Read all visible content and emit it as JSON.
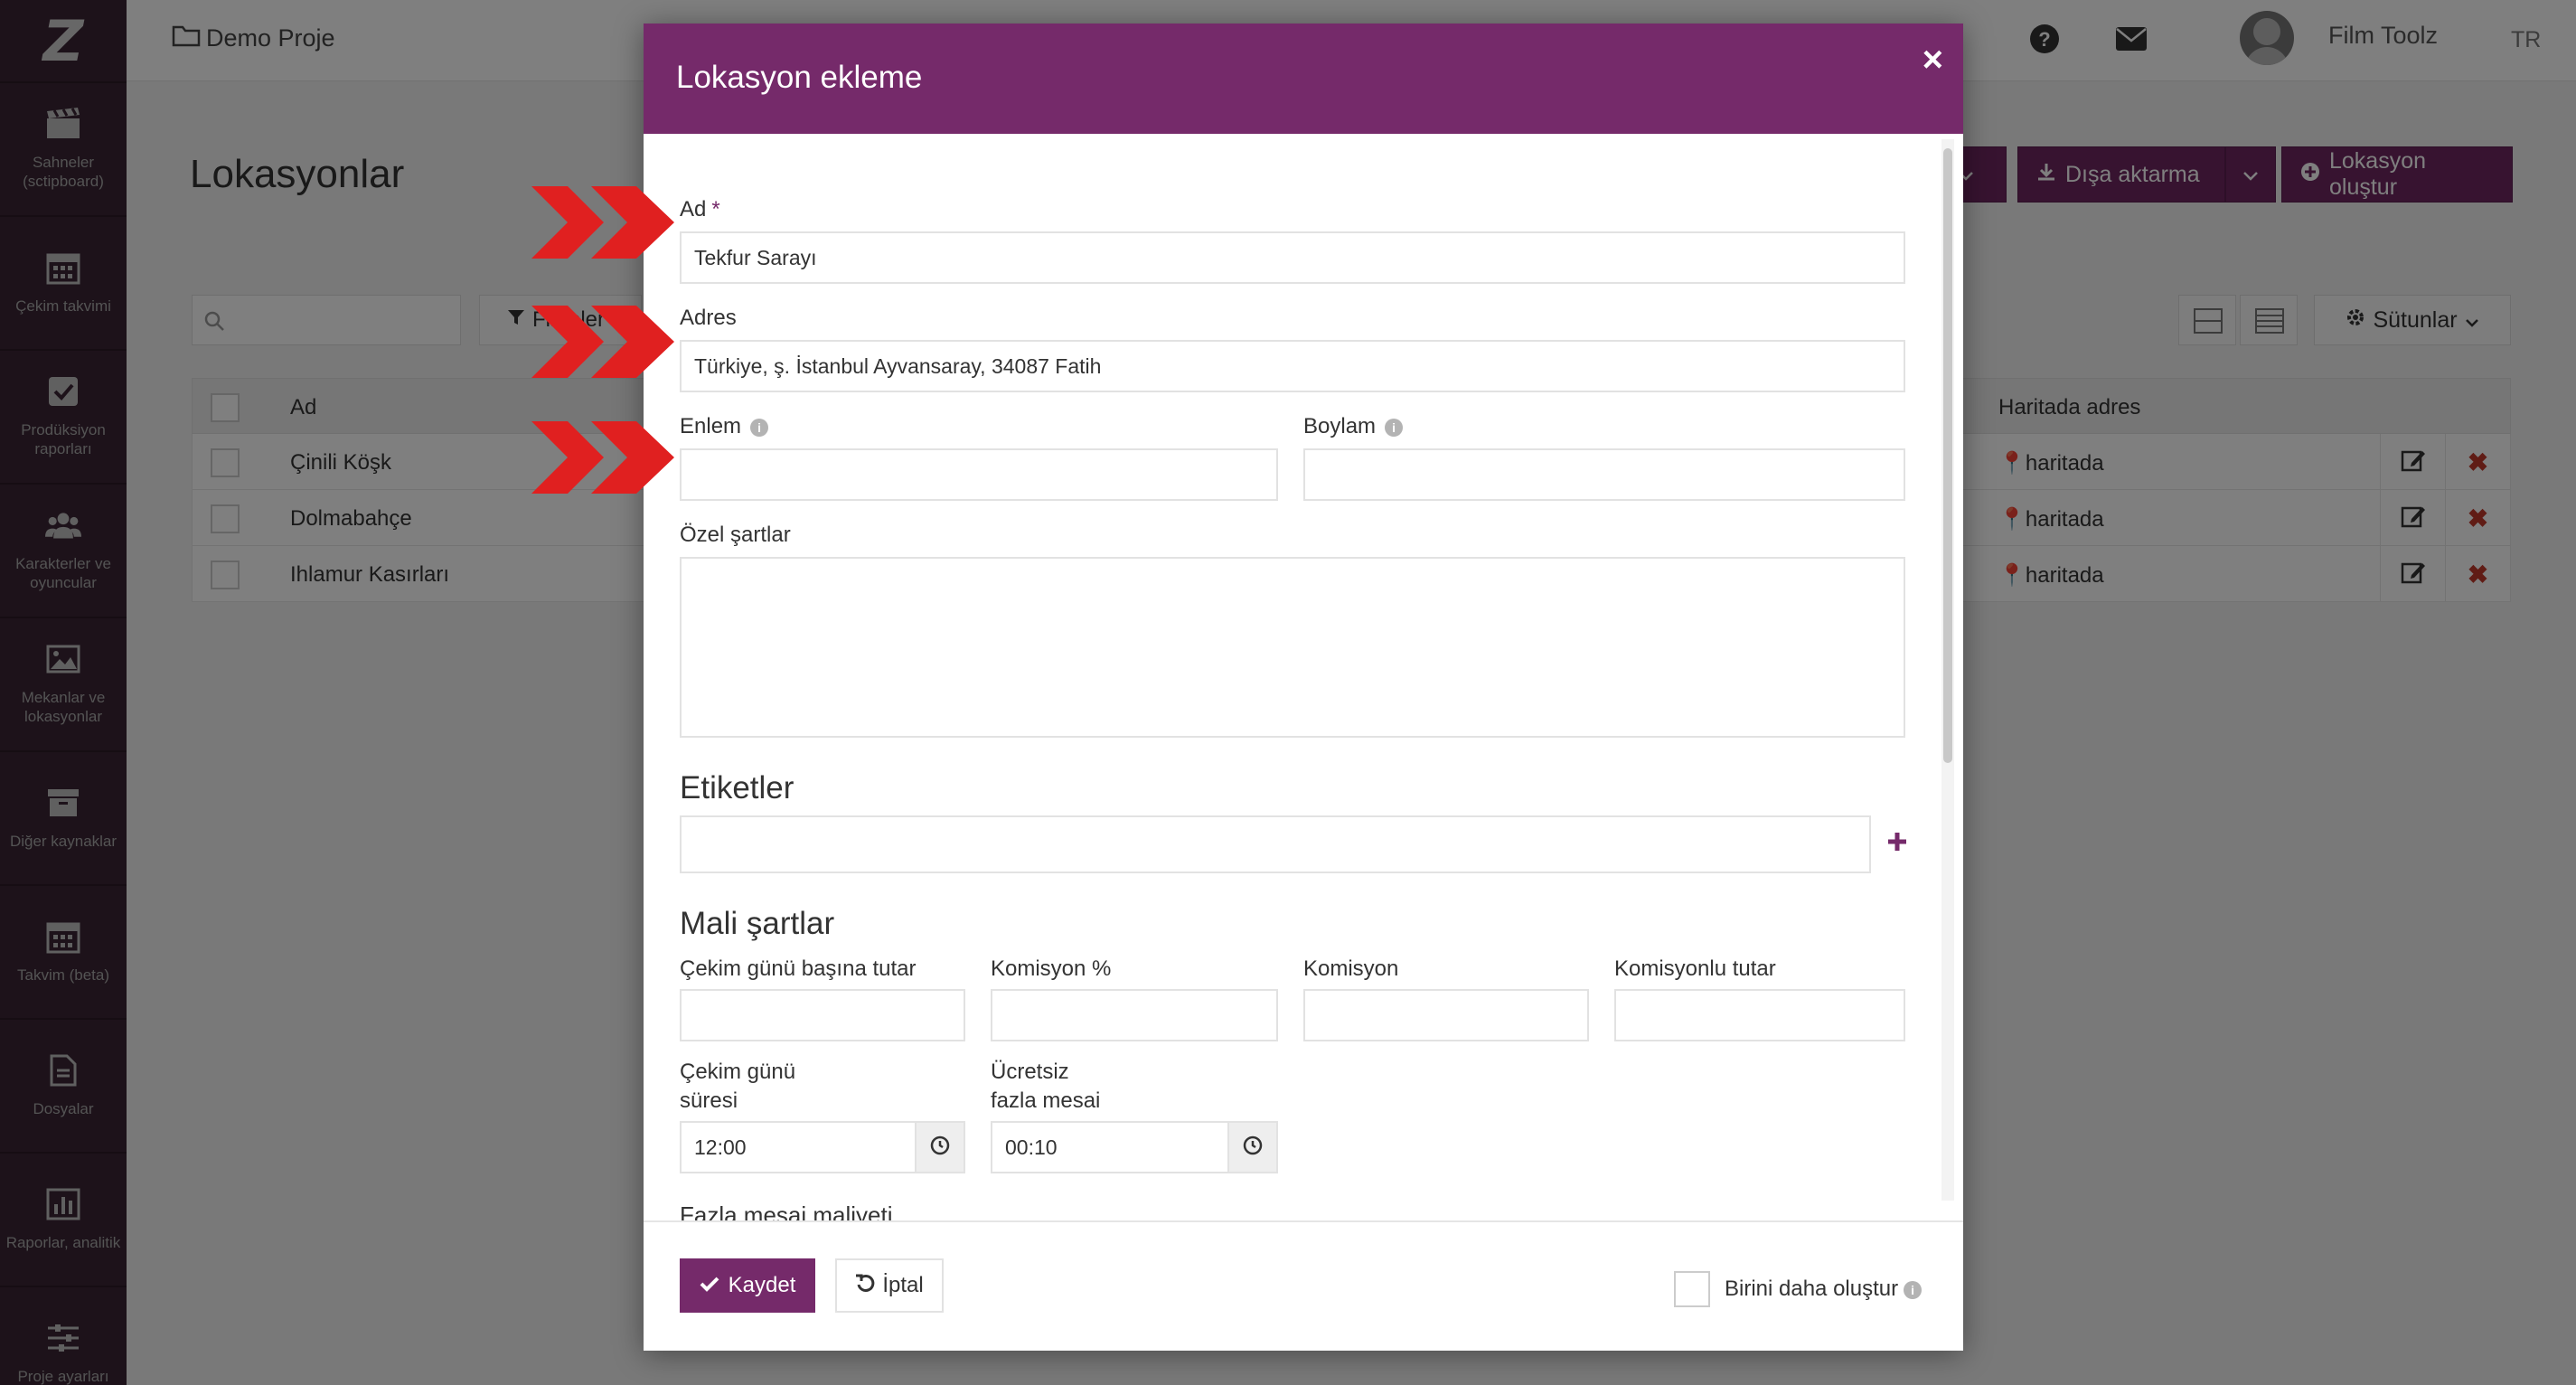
{
  "sidebar": {
    "logo": "Z",
    "items": [
      {
        "label": "Sahneler (sctipboard)",
        "icon": "clapperboard-icon"
      },
      {
        "label": "Çekim takvimi",
        "icon": "calendar-icon"
      },
      {
        "label": "Prodüksiyon raporları",
        "icon": "checkbox-icon"
      },
      {
        "label": "Karakterler ve oyuncular",
        "icon": "users-icon"
      },
      {
        "label": "Mekanlar ve lokasyonlar",
        "icon": "image-icon"
      },
      {
        "label": "Diğer kaynaklar",
        "icon": "archive-icon"
      },
      {
        "label": "Takvim (beta)",
        "icon": "calendar-icon"
      },
      {
        "label": "Dosyalar",
        "icon": "file-icon"
      },
      {
        "label": "Raporlar, analitik",
        "icon": "bar-chart-icon"
      },
      {
        "label": "Proje ayarları",
        "icon": "sliders-icon"
      }
    ]
  },
  "topbar": {
    "project": "Demo Proje",
    "user": "Film Toolz",
    "lang": "TR"
  },
  "page": {
    "title": "Lokasyonlar",
    "export_label": "Dışa aktarma",
    "create_label": "Lokasyon oluştur",
    "filter_label": "Filtreler",
    "columns_label": "Sütunlar",
    "table": {
      "col_name": "Ad",
      "col_map": "Haritada adres",
      "rows": [
        {
          "name": "Çinili Köşk",
          "map": "haritada"
        },
        {
          "name": "Dolmabahçe",
          "map": "haritada"
        },
        {
          "name": "Ihlamur Kasırları",
          "map": "haritada"
        }
      ]
    }
  },
  "modal": {
    "title": "Lokasyon ekleme",
    "close": "×",
    "fields": {
      "ad_label": "Ad",
      "ad_required": "*",
      "ad_value": "Tekfur Sarayı",
      "adres_label": "Adres",
      "adres_value": "Türkiye, ş. İstanbul Ayvansaray, 34087 Fatih",
      "enlem_label": "Enlem",
      "enlem_value": "",
      "boylam_label": "Boylam",
      "boylam_value": "",
      "ozel_label": "Özel şartlar",
      "ozel_value": ""
    },
    "tags": {
      "heading": "Etiketler",
      "value": "",
      "add": "+"
    },
    "finance": {
      "heading": "Mali şartlar",
      "per_day_label": "Çekim günü başına tutar",
      "commission_pct_label": "Komisyon %",
      "commission_label": "Komisyon",
      "with_commission_label": "Komisyonlu tutar",
      "day_duration_label_1": "Çekim günü",
      "day_duration_label_2": "süresi",
      "day_duration_value": "12:00",
      "free_overtime_label_1": "Ücretsiz",
      "free_overtime_label_2": "fazla mesai",
      "free_overtime_value": "00:10",
      "overtime_cost_label": "Fazla mesai maliyeti"
    },
    "footer": {
      "save": "Kaydet",
      "cancel": "İptal",
      "create_another": "Birini daha oluştur"
    }
  },
  "colors": {
    "brand": "#752a6a",
    "sidebar": "#3a2434",
    "arrow": "#e02020"
  }
}
